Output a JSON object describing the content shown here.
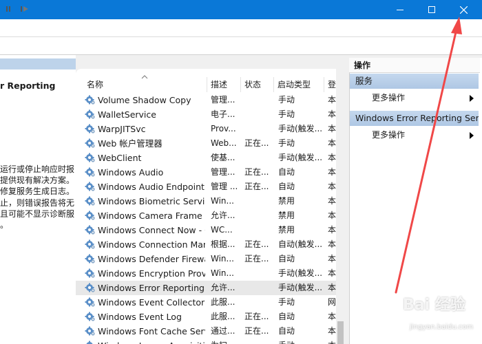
{
  "window": {
    "buttons": [
      {
        "name": "minimize",
        "icon": "minimize-icon"
      },
      {
        "name": "maximize",
        "icon": "maximize-icon"
      },
      {
        "name": "close",
        "icon": "close-icon"
      }
    ],
    "title_bar_color": "#0a78d7"
  },
  "toolbar": {
    "buttons": [
      {
        "name": "pause-service",
        "icon": "pause-icon"
      },
      {
        "name": "resume-service",
        "icon": "resume-icon"
      }
    ]
  },
  "description": {
    "title": "r Reporting",
    "lines": [
      "运行或停止响应时报",
      "提供现有解决方案。",
      "修复服务生成日志。",
      "止，则错误报告将无",
      "且可能不显示诊断服",
      "。"
    ]
  },
  "services": {
    "columns": [
      "名称",
      "描述",
      "状态",
      "启动类型",
      "登"
    ],
    "rows": [
      {
        "name": "Volume Shadow Copy",
        "desc": "管理...",
        "status": "",
        "startup": "手动",
        "logon": "本"
      },
      {
        "name": "WalletService",
        "desc": "电子...",
        "status": "",
        "startup": "手动",
        "logon": "本"
      },
      {
        "name": "WarpJITSvc",
        "desc": "Prov...",
        "status": "",
        "startup": "手动(触发...",
        "logon": "本"
      },
      {
        "name": "Web 帐户管理器",
        "desc": "Web...",
        "status": "正在...",
        "startup": "手动",
        "logon": "本"
      },
      {
        "name": "WebClient",
        "desc": "使基...",
        "status": "",
        "startup": "手动(触发...",
        "logon": "本"
      },
      {
        "name": "Windows Audio",
        "desc": "管理...",
        "status": "正在...",
        "startup": "自动",
        "logon": "本"
      },
      {
        "name": "Windows Audio Endpoint Builder",
        "desc": "管理 ...",
        "status": "正在...",
        "startup": "自动",
        "logon": "本"
      },
      {
        "name": "Windows Biometric Service",
        "desc": "Win...",
        "status": "",
        "startup": "禁用",
        "logon": "本"
      },
      {
        "name": "Windows Camera Frame Server",
        "desc": "允许...",
        "status": "",
        "startup": "禁用",
        "logon": "本"
      },
      {
        "name": "Windows Connect Now - Config Registrar",
        "desc": "WC...",
        "status": "",
        "startup": "禁用",
        "logon": "本"
      },
      {
        "name": "Windows Connection Manager",
        "desc": "根据...",
        "status": "正在...",
        "startup": "自动(触发...",
        "logon": "本"
      },
      {
        "name": "Windows Defender Firewall",
        "desc": "Win...",
        "status": "正在...",
        "startup": "自动",
        "logon": "本"
      },
      {
        "name": "Windows Encryption Provider",
        "desc": "Win...",
        "status": "",
        "startup": "手动(触发...",
        "logon": "本"
      },
      {
        "name": "Windows Error Reporting Service",
        "desc": "允许...",
        "status": "",
        "startup": "手动(触发...",
        "logon": "本",
        "selected": true
      },
      {
        "name": "Windows Event Collector",
        "desc": "此服...",
        "status": "",
        "startup": "手动",
        "logon": "网"
      },
      {
        "name": "Windows Event Log",
        "desc": "此服...",
        "status": "正在...",
        "startup": "自动",
        "logon": "本"
      },
      {
        "name": "Windows Font Cache Service",
        "desc": "通过...",
        "status": "正在...",
        "startup": "自动",
        "logon": "本"
      },
      {
        "name": "Windows Image Acquisition",
        "desc": "为扫...",
        "status": "",
        "startup": "手动",
        "logon": "本"
      }
    ]
  },
  "actions": {
    "title": "操作",
    "groups": [
      {
        "label": "服务",
        "item": "更多操作"
      },
      {
        "label": "Windows Error Reporting Service",
        "item": "更多操作"
      }
    ]
  },
  "annotation": {
    "color": "#f04848"
  },
  "watermark": {
    "line1": "Bai 经验",
    "line2": "jingyan.baidu.com"
  }
}
